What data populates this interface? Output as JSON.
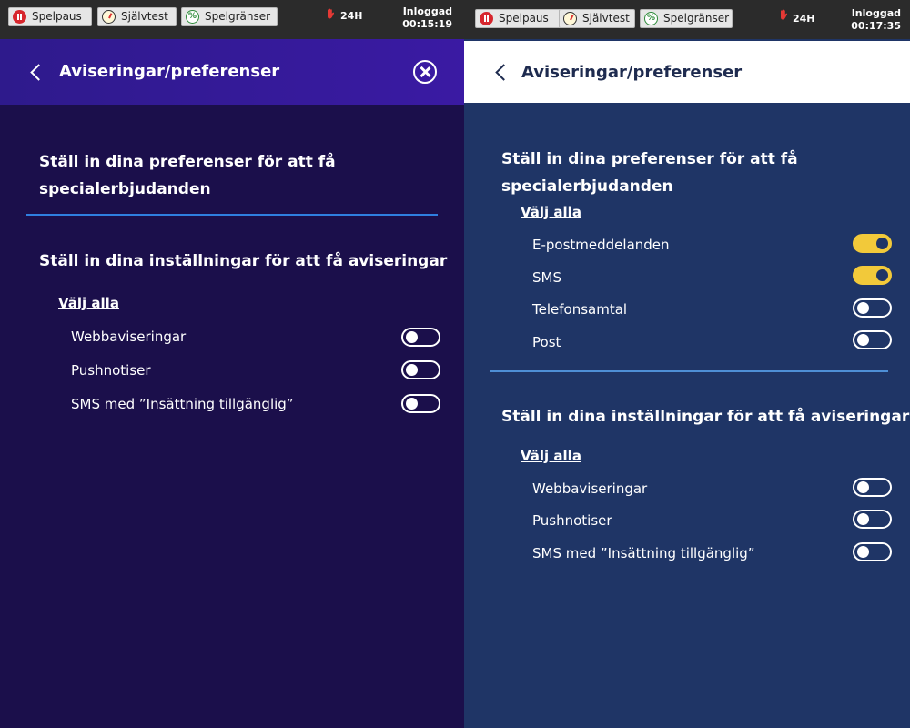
{
  "left": {
    "topbar": {
      "buttons": [
        {
          "label": "Spelpaus",
          "icon": "pause-icon"
        },
        {
          "label": "Självtest",
          "icon": "gauge-icon"
        },
        {
          "label": "Spelgränser",
          "icon": "limit-icon"
        }
      ],
      "badge": "24H",
      "login_label": "Inloggad",
      "login_time": "00:15:19"
    },
    "header": {
      "title": "Aviseringar/preferenser"
    },
    "offers_heading": "Ställ in dina preferenser för att få specialerbjudanden",
    "notifications": {
      "heading": "Ställ in dina inställningar för att få aviseringar",
      "select_all": "Välj alla",
      "items": [
        {
          "label": "Webbaviseringar",
          "on": false
        },
        {
          "label": "Pushnotiser",
          "on": false
        },
        {
          "label": "SMS med ”Insättning tillgänglig”",
          "on": false
        }
      ]
    }
  },
  "right": {
    "topbar": {
      "buttons": [
        {
          "label": "Spelpaus",
          "icon": "pause-icon"
        },
        {
          "label": "Självtest",
          "icon": "gauge-icon"
        },
        {
          "label": "Spelgränser",
          "icon": "limit-icon"
        }
      ],
      "badge": "24H",
      "login_label": "Inloggad",
      "login_time": "00:17:35"
    },
    "header": {
      "title": "Aviseringar/preferenser"
    },
    "offers": {
      "heading": "Ställ in dina preferenser för att få specialerbjudanden",
      "select_all": "Välj alla",
      "items": [
        {
          "label": "E-postmeddelanden",
          "on": true
        },
        {
          "label": "SMS",
          "on": true
        },
        {
          "label": "Telefonsamtal",
          "on": false
        },
        {
          "label": "Post",
          "on": false
        }
      ]
    },
    "notifications": {
      "heading": "Ställ in dina inställningar för att få aviseringar",
      "select_all": "Välj alla",
      "items": [
        {
          "label": "Webbaviseringar",
          "on": false
        },
        {
          "label": "Pushnotiser",
          "on": false
        },
        {
          "label": "SMS med ”Insättning tillgänglig”",
          "on": false
        }
      ]
    }
  },
  "colors": {
    "left_bg": "#1b0f4b",
    "left_header": "#3a1aa3",
    "right_bg": "#1f3566",
    "toggle_on": "#f2c93a"
  }
}
